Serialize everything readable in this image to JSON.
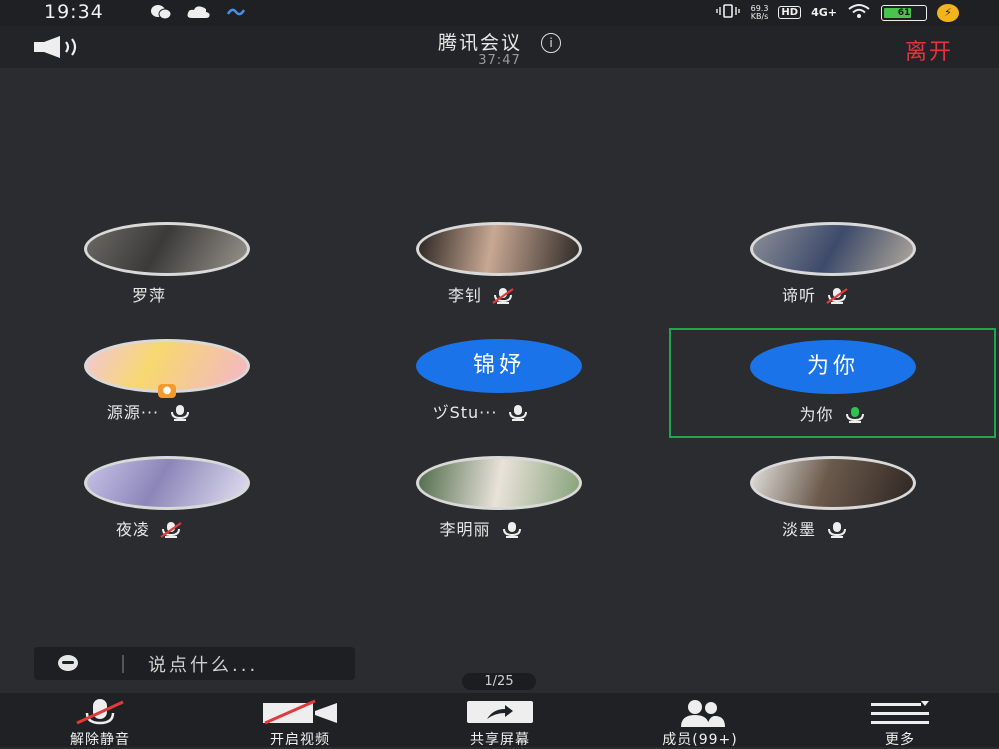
{
  "status_bar": {
    "time": "19:34",
    "net_speed": "69.3\nKB/s",
    "hd": "HD",
    "signal": "4G+",
    "battery": "61"
  },
  "header": {
    "title": "腾讯会议",
    "timer": "37:47",
    "leave_label": "离开"
  },
  "participants": [
    {
      "name": "罗萍",
      "mic": "none",
      "avatar": "photo"
    },
    {
      "name": "李钊",
      "mic": "muted",
      "avatar": "photo"
    },
    {
      "name": "谛听",
      "mic": "muted",
      "avatar": "photo"
    },
    {
      "name": "源源···",
      "mic": "on",
      "avatar": "photo",
      "host": true
    },
    {
      "name": "ヅStu···",
      "mic": "on",
      "avatar": "text",
      "avatar_text": "锦妤"
    },
    {
      "name": "为你",
      "mic": "speaking",
      "avatar": "text",
      "avatar_text": "为你",
      "active": true
    },
    {
      "name": "夜凌",
      "mic": "muted",
      "avatar": "photo"
    },
    {
      "name": "李明丽",
      "mic": "on",
      "avatar": "photo"
    },
    {
      "name": "淡墨",
      "mic": "on",
      "avatar": "photo"
    }
  ],
  "chat": {
    "placeholder": "说点什么..."
  },
  "pager": "1/25",
  "toolbar": {
    "unmute_label": "解除静音",
    "video_label": "开启视频",
    "share_label": "共享屏幕",
    "members_label": "成员(99+)",
    "more_label": "更多"
  },
  "colors": {
    "background": "#2b2c30",
    "accent_blue": "#1a73e8",
    "leave_red": "#e7333b",
    "active_green": "#21a650",
    "muted_red": "#e03a3a"
  }
}
